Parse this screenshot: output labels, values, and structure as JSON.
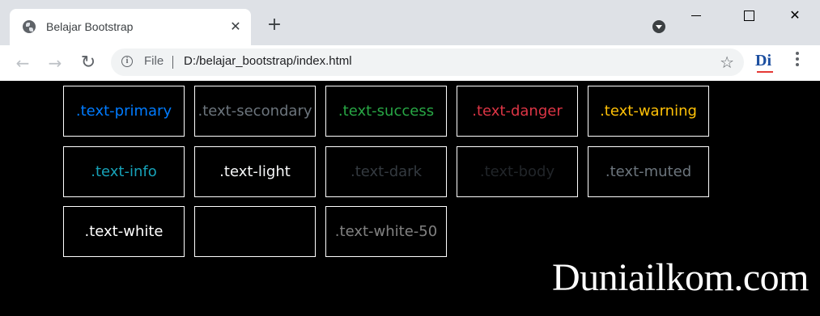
{
  "browser": {
    "tab_title": "Belajar Bootstrap",
    "tab_close": "✕",
    "new_tab": "+",
    "file_label": "File",
    "url": "D:/belajar_bootstrap/index.html",
    "extension_label": "Di",
    "icons": [
      "globe-icon",
      "close-icon",
      "plus-icon",
      "profile-icon",
      "minimize-icon",
      "maximize-icon",
      "close-window-icon",
      "back-icon",
      "forward-icon",
      "reload-icon",
      "info-icon",
      "star-icon",
      "menu-icon"
    ]
  },
  "boxes": [
    {
      "label": ".text-primary",
      "color": "#007bff"
    },
    {
      "label": ".text-secondary",
      "color": "#6c757d"
    },
    {
      "label": ".text-success",
      "color": "#28a745"
    },
    {
      "label": ".text-danger",
      "color": "#dc3545"
    },
    {
      "label": ".text-warning",
      "color": "#ffc107"
    },
    {
      "label": ".text-info",
      "color": "#17a2b8"
    },
    {
      "label": ".text-light",
      "color": "#f8f9fa"
    },
    {
      "label": ".text-dark",
      "color": "#343a40"
    },
    {
      "label": ".text-body",
      "color": "#212529"
    },
    {
      "label": ".text-muted",
      "color": "#6c757d"
    },
    {
      "label": ".text-white",
      "color": "#ffffff"
    },
    {
      "label": "",
      "color": "#ffffff"
    },
    {
      "label": ".text-white-50",
      "color": "rgba(255,255,255,0.5)"
    }
  ],
  "watermark": "Duniailkom.com"
}
